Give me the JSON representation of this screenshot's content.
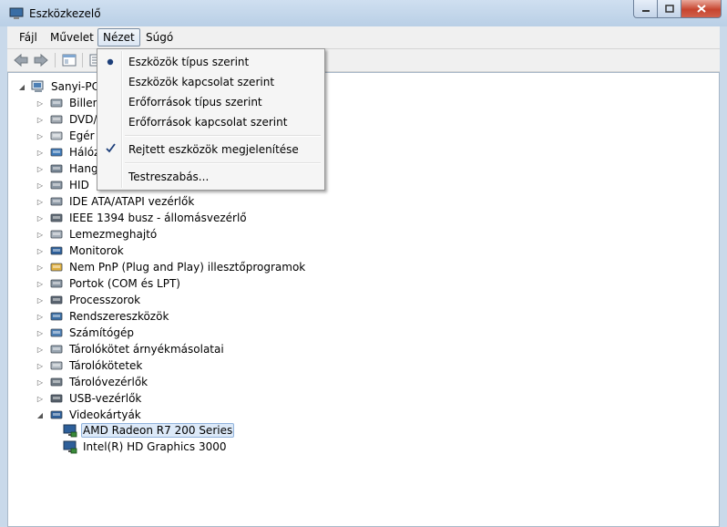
{
  "window": {
    "title": "Eszközkezelő"
  },
  "menubar": {
    "items": [
      "Fájl",
      "Művelet",
      "Nézet",
      "Súgó"
    ],
    "active": "Nézet"
  },
  "view_menu": {
    "items": [
      {
        "label": "Eszközök típus szerint",
        "mark": "radio"
      },
      {
        "label": "Eszközök kapcsolat szerint",
        "mark": ""
      },
      {
        "label": "Erőforrások típus szerint",
        "mark": ""
      },
      {
        "label": "Erőforrások kapcsolat szerint",
        "mark": ""
      },
      {
        "label": "Rejtett eszközök megjelenítése",
        "mark": "check"
      },
      {
        "label": "Testreszabás...",
        "mark": ""
      }
    ]
  },
  "tree": {
    "root": "Sanyi-PC",
    "categories": [
      {
        "label": "Billentyűzetek",
        "shown": "Billent",
        "icon": "keyboard-icon"
      },
      {
        "label": "DVD/CD-ROM meghajtók",
        "shown": "DVD/C",
        "icon": "dvd-drive-icon"
      },
      {
        "label": "Egér vagy más mutatóeszköz",
        "shown": "Egér v",
        "icon": "mouse-icon"
      },
      {
        "label": "Hálózati kártyák",
        "shown": "Hálóz",
        "icon": "network-adapter-icon"
      },
      {
        "label": "Hang-, video- és játékvezérlők",
        "shown": "Hang-",
        "icon": "speaker-icon"
      },
      {
        "label": "HID",
        "shown": "HID",
        "icon": "hid-icon"
      },
      {
        "label": "IDE ATA/ATAPI vezérlők",
        "shown": "IDE ATA/ATAPI vezérlők",
        "icon": "ide-controller-icon"
      },
      {
        "label": "IEEE 1394 busz - állomásvezérlő",
        "shown": "IEEE 1394 busz - állomásvezérlő",
        "icon": "ieee1394-icon"
      },
      {
        "label": "Lemezmeghajtó",
        "shown": "Lemezmeghajtó",
        "icon": "disk-drive-icon"
      },
      {
        "label": "Monitorok",
        "shown": "Monitorok",
        "icon": "monitor-icon"
      },
      {
        "label": "Nem PnP (Plug and Play) illesztőprogramok",
        "shown": "Nem PnP (Plug and Play) illesztőprogramok",
        "icon": "non-pnp-driver-icon"
      },
      {
        "label": "Portok (COM és LPT)",
        "shown": "Portok (COM és LPT)",
        "icon": "port-icon"
      },
      {
        "label": "Processzorok",
        "shown": "Processzorok",
        "icon": "processor-icon"
      },
      {
        "label": "Rendszereszközök",
        "shown": "Rendszereszközök",
        "icon": "system-device-icon"
      },
      {
        "label": "Számítógép",
        "shown": "Számítógép",
        "icon": "computer-icon"
      },
      {
        "label": "Tárolókötet árnyékmásolatai",
        "shown": "Tárolókötet árnyékmásolatai",
        "icon": "shadow-copy-icon"
      },
      {
        "label": "Tárolókötetek",
        "shown": "Tárolókötetek",
        "icon": "storage-volume-icon"
      },
      {
        "label": "Tárolóvezérlők",
        "shown": "Tárolóvezérlők",
        "icon": "storage-controller-icon"
      },
      {
        "label": "USB-vezérlők",
        "shown": "USB-vezérlők",
        "icon": "usb-icon"
      },
      {
        "label": "Videokártyák",
        "shown": "Videokártyák",
        "icon": "display-adapter-icon",
        "expanded": true
      }
    ],
    "video_children": [
      {
        "label": "AMD Radeon R7 200 Series",
        "selected": true
      },
      {
        "label": "Intel(R) HD Graphics 3000",
        "selected": false
      }
    ]
  }
}
